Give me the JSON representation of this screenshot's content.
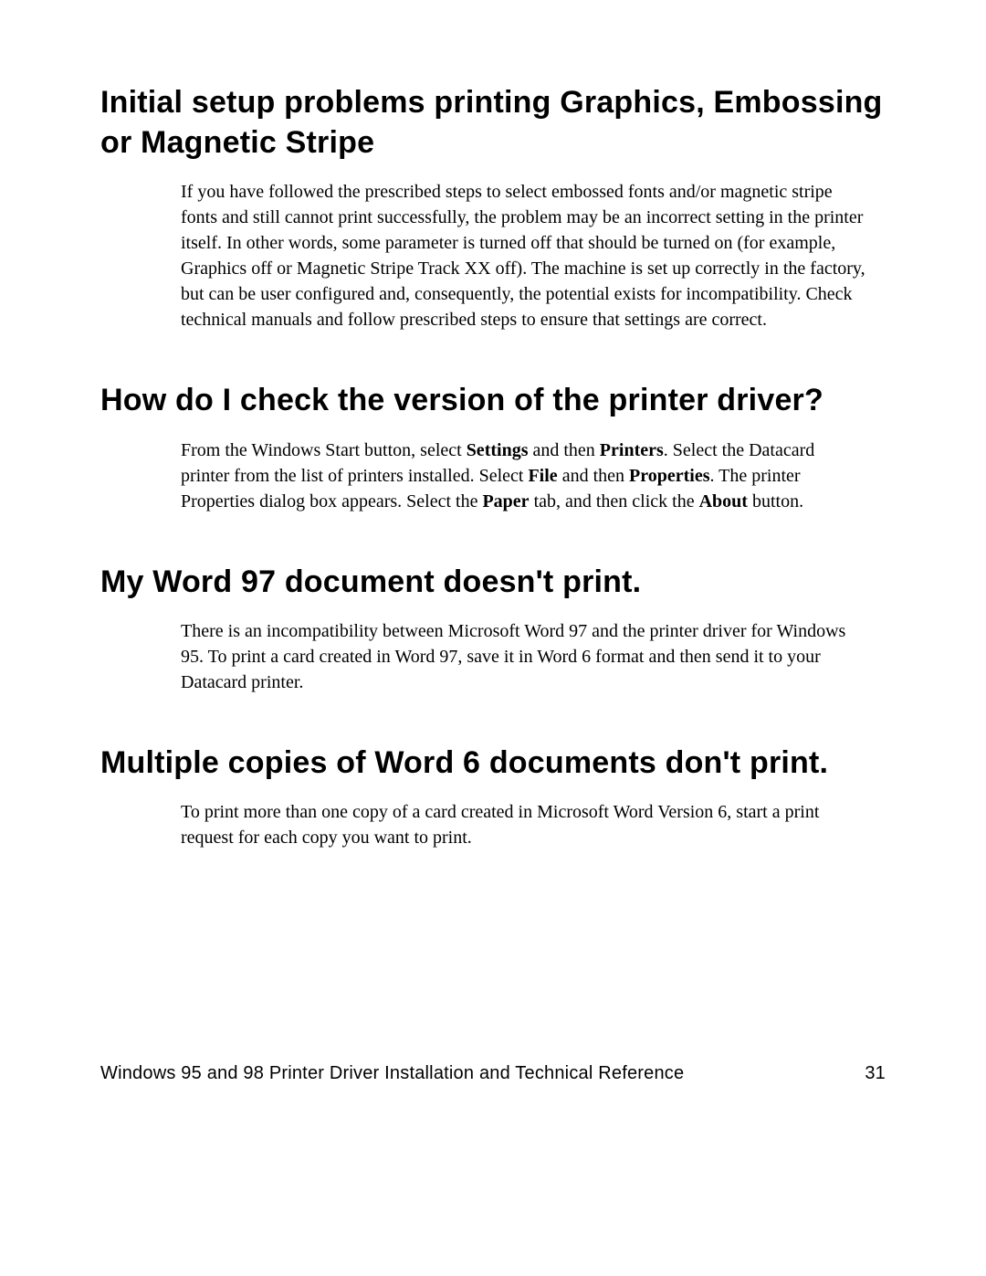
{
  "sections": [
    {
      "heading": "Initial setup problems printing Graphics, Embossing or Magnetic Stripe",
      "body_plain": "If you have followed the prescribed steps to select embossed fonts and/or magnetic stripe fonts and still cannot print successfully, the problem may be an incorrect setting in the printer itself. In other words, some parameter is turned off that should be turned on (for example, Graphics off or Magnetic Stripe Track XX off). The machine is set up correctly in the factory, but can be user configured and, consequently, the potential exists for incompatibility. Check technical manuals and follow prescribed steps to ensure that settings are correct."
    },
    {
      "heading": "How do I check the version of the printer driver?",
      "body_runs": [
        {
          "t": "From the Windows Start button, select ",
          "b": false
        },
        {
          "t": "Settings",
          "b": true
        },
        {
          "t": " and then ",
          "b": false
        },
        {
          "t": "Printers",
          "b": true
        },
        {
          "t": ". Select the Datacard printer from the list of printers installed. Select ",
          "b": false
        },
        {
          "t": "File",
          "b": true
        },
        {
          "t": " and then ",
          "b": false
        },
        {
          "t": "Properties",
          "b": true
        },
        {
          "t": ". The printer Properties dialog box appears. Select the ",
          "b": false
        },
        {
          "t": "Paper",
          "b": true
        },
        {
          "t": " tab, and then click the ",
          "b": false
        },
        {
          "t": "About",
          "b": true
        },
        {
          "t": " button.",
          "b": false
        }
      ]
    },
    {
      "heading": "My Word 97 document doesn't print.",
      "body_plain": "There is an incompatibility between Microsoft Word 97 and the printer driver for Windows 95. To print a card created in Word 97, save it in Word 6 format and then send it to your Datacard printer."
    },
    {
      "heading": "Multiple copies of Word 6 documents don't print.",
      "body_plain": "To print more than one copy of a card created in Microsoft Word Version 6, start a print request for each copy you want to print."
    }
  ],
  "footer": {
    "title": "Windows 95 and 98 Printer Driver Installation and Technical Reference",
    "page_number": "31"
  }
}
